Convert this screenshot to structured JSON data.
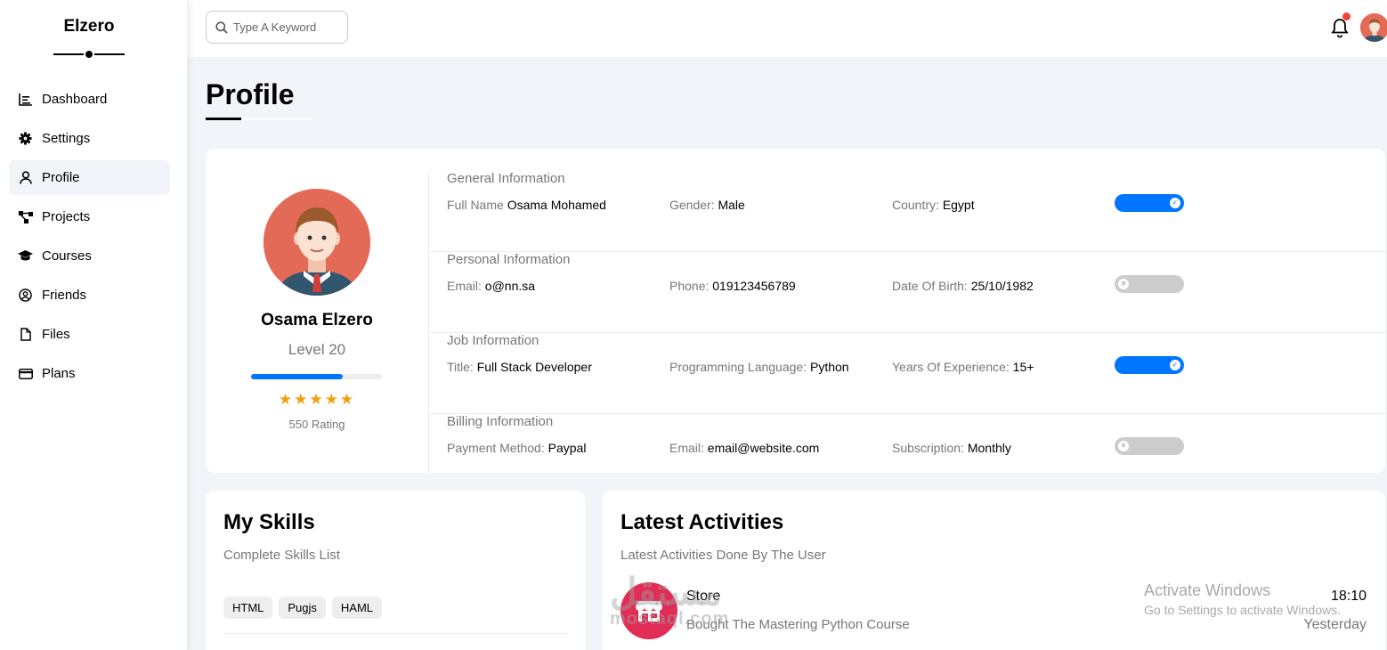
{
  "sidebar": {
    "brand": "Elzero",
    "items": [
      {
        "label": "Dashboard",
        "icon": "chart-icon"
      },
      {
        "label": "Settings",
        "icon": "gear-icon"
      },
      {
        "label": "Profile",
        "icon": "user-icon",
        "active": true
      },
      {
        "label": "Projects",
        "icon": "diagram-icon"
      },
      {
        "label": "Courses",
        "icon": "graduation-cap-icon"
      },
      {
        "label": "Friends",
        "icon": "user-circle-icon"
      },
      {
        "label": "Files",
        "icon": "file-icon"
      },
      {
        "label": "Plans",
        "icon": "credit-card-icon"
      }
    ]
  },
  "header": {
    "search_placeholder": "Type A Keyword",
    "notification_icon": "bell-icon",
    "avatar_icon": "avatar"
  },
  "page": {
    "title": "Profile"
  },
  "profile": {
    "name": "Osama Elzero",
    "level": "Level 20",
    "progress": 0.7,
    "stars": "★★★★★",
    "rating": "550 Rating",
    "sections": [
      {
        "title": "General Information",
        "toggle_on": true,
        "fields": [
          {
            "label": "Full Name",
            "value": "Osama Mohamed"
          },
          {
            "label": "Gender:",
            "value": "Male"
          },
          {
            "label": "Country:",
            "value": "Egypt"
          }
        ]
      },
      {
        "title": "Personal Information",
        "toggle_on": false,
        "fields": [
          {
            "label": "Email:",
            "value": "o@nn.sa"
          },
          {
            "label": "Phone:",
            "value": "019123456789"
          },
          {
            "label": "Date Of Birth:",
            "value": "25/10/1982"
          }
        ]
      },
      {
        "title": "Job Information",
        "toggle_on": true,
        "fields": [
          {
            "label": "Title:",
            "value": "Full Stack Developer"
          },
          {
            "label": "Programming Language:",
            "value": "Python"
          },
          {
            "label": "Years Of Experience:",
            "value": "15+"
          }
        ]
      },
      {
        "title": "Billing Information",
        "toggle_on": false,
        "fields": [
          {
            "label": "Payment Method:",
            "value": "Paypal"
          },
          {
            "label": "Email:",
            "value": "email@website.com"
          },
          {
            "label": "Subscription:",
            "value": "Monthly"
          }
        ]
      }
    ]
  },
  "skills": {
    "title": "My Skills",
    "subtitle": "Complete Skills List",
    "items": [
      "HTML",
      "Pugjs",
      "HAML"
    ]
  },
  "activities": {
    "title": "Latest Activities",
    "subtitle": "Latest Activities Done By The User",
    "items": [
      {
        "title": "Store",
        "desc": "Bought The Mastering Python Course",
        "time": "18:10",
        "day": "Yesterday",
        "icon": "store-icon"
      }
    ]
  },
  "watermark": {
    "windows_line1": "Activate Windows",
    "windows_line2": "Go to Settings to activate Windows.",
    "logo": "مستقل",
    "logo_sub": "mostaql.com"
  },
  "colors": {
    "accent": "#0075ff",
    "avatar_bg": "#e36a57",
    "activity_icon_bg": "#e12c55",
    "star": "#f59e0b",
    "page_bg": "#f1f5f9"
  }
}
